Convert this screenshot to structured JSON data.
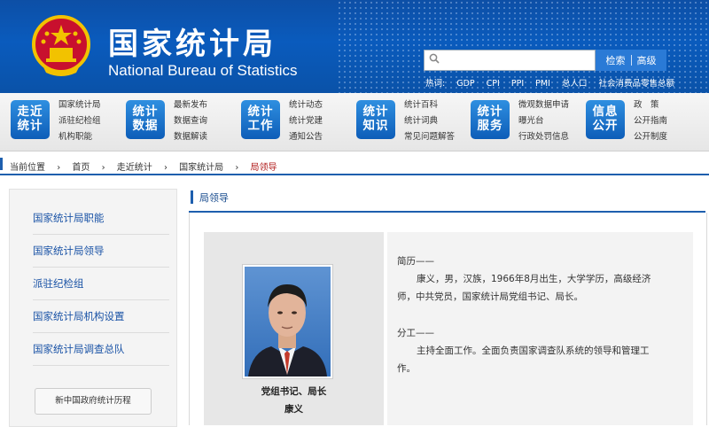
{
  "header": {
    "title_cn": "国家统计局",
    "title_en": "National Bureau of Statistics",
    "search_button": "检索",
    "advanced_button": "高级",
    "hot_label": "热词:",
    "hot_words": [
      "GDP",
      "CPI",
      "PPI",
      "PMI",
      "总人口",
      "社会消费品零售总额"
    ],
    "colors": {
      "header_blue": "#0a5bbd",
      "accent_red": "#b01c1c"
    }
  },
  "nav": [
    {
      "badge": "走近\n统计",
      "links": [
        "国家统计局",
        "派驻纪检组",
        "机构职能"
      ]
    },
    {
      "badge": "统计\n数据",
      "links": [
        "最新发布",
        "数据查询",
        "数据解读"
      ]
    },
    {
      "badge": "统计\n工作",
      "links": [
        "统计动态",
        "统计党建",
        "通知公告"
      ]
    },
    {
      "badge": "统计\n知识",
      "links": [
        "统计百科",
        "统计词典",
        "常见问题解答"
      ]
    },
    {
      "badge": "统计\n服务",
      "links": [
        "微观数据申请",
        "曝光台",
        "行政处罚信息"
      ]
    },
    {
      "badge": "信息\n公开",
      "links": [
        "政　策",
        "公开指南",
        "公开制度"
      ]
    }
  ],
  "breadcrumb": [
    "当前位置",
    "首页",
    "走近统计",
    "国家统计局",
    "局领导"
  ],
  "sidebar": {
    "items": [
      "国家统计局职能",
      "国家统计局领导",
      "派驻纪检组",
      "国家统计局机构设置",
      "国家统计局调查总队"
    ],
    "button": "新中国政府统计历程"
  },
  "main": {
    "section_title": "局领导",
    "position": "党组书记、局长",
    "name": "康义",
    "resume_heading": "简历——",
    "resume_lines": [
      "康义，男，汉族，1966年8月出生，大学学历，高级经济",
      "师，中共党员，国家统计局党组书记、局长。"
    ],
    "duty_heading": "分工——",
    "duty_lines": [
      "主持全面工作。全面负责国家调查队系统的领导和管理工",
      "作。"
    ]
  }
}
